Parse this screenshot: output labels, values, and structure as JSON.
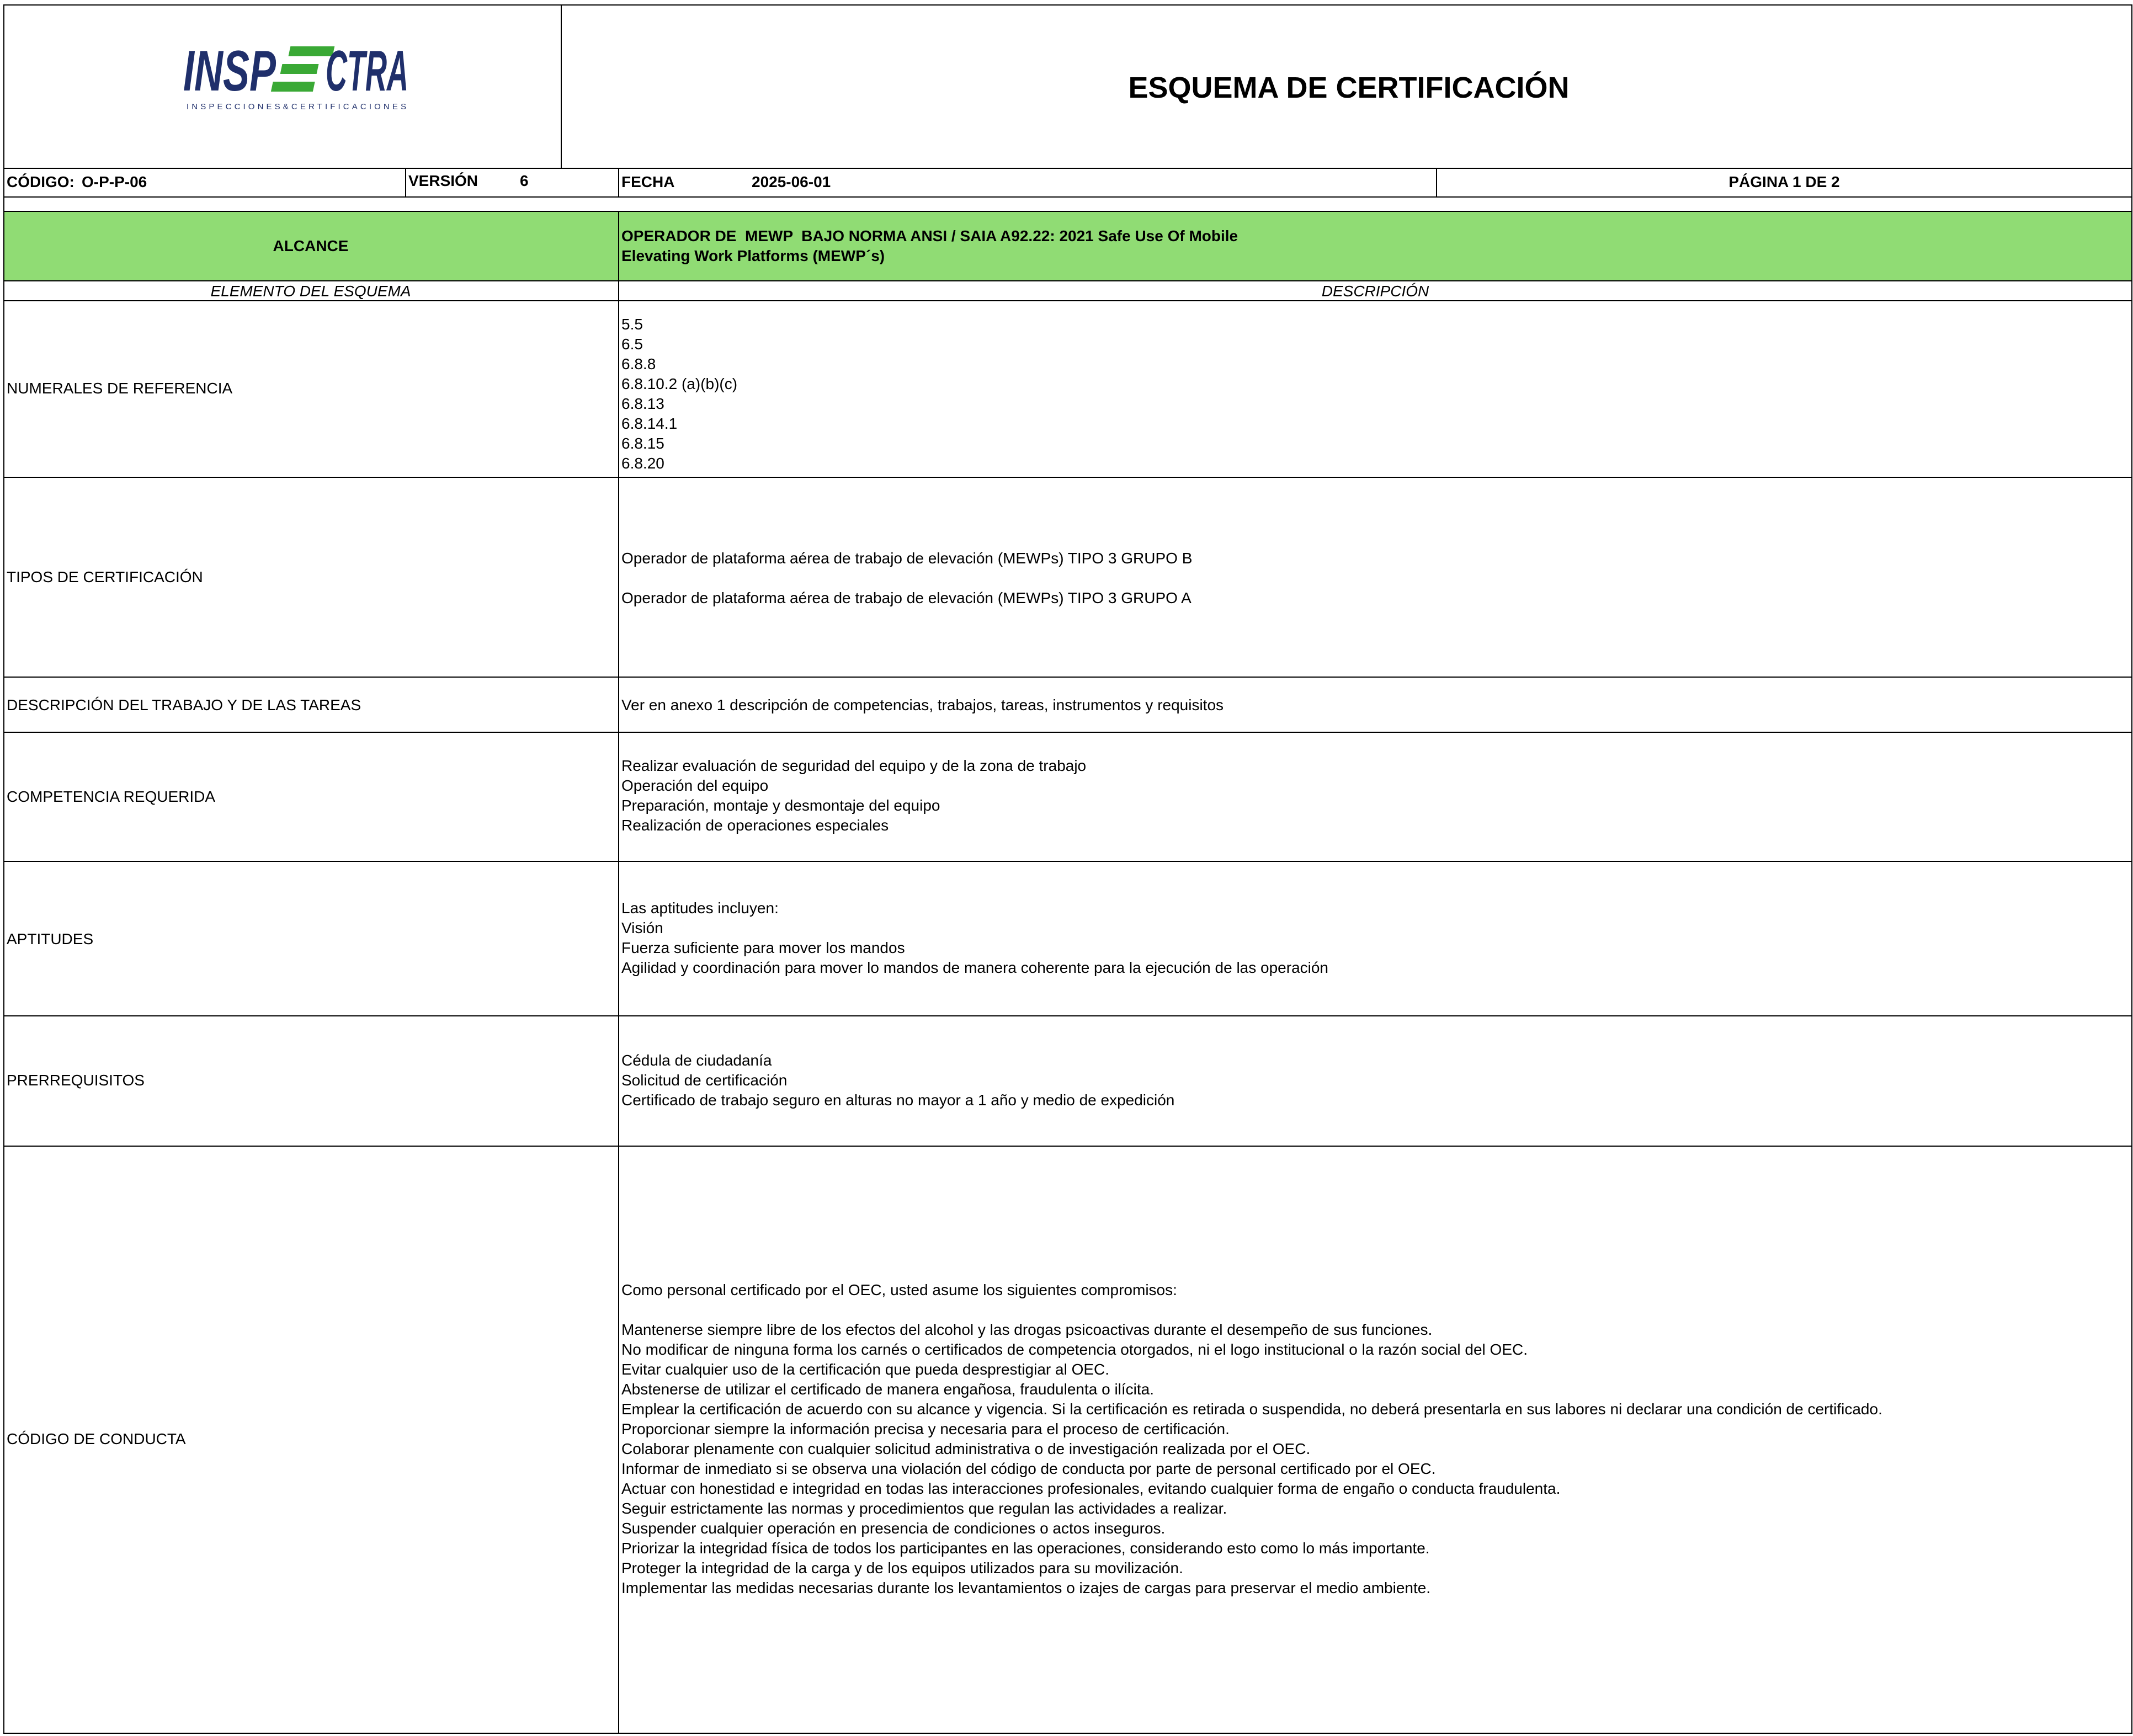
{
  "header": {
    "logo_text": "INSPECTRA",
    "logo_tagline": "INSPECCIONES&CERTIFICACIONES",
    "title": "ESQUEMA DE CERTIFICACIÓN",
    "codigo_label": "CÓDIGO:",
    "codigo_value": "O-P-P-06",
    "version_label": "VERSIÓN",
    "version_value": "6",
    "fecha_label": "FECHA",
    "fecha_value": "2025-06-01",
    "pagina": "PÁGINA 1 DE 2"
  },
  "alcance": {
    "label": "ALCANCE",
    "line1": "OPERADOR DE  MEWP  BAJO NORMA ANSI / SAIA A92.22: 2021 Safe Use Of Mobile",
    "line2": "Elevating Work Platforms (MEWP´s)"
  },
  "columns": {
    "left": "ELEMENTO DEL ESQUEMA",
    "right": "DESCRIPCIÓN"
  },
  "rows": {
    "numerales": {
      "label": "NUMERALES DE REFERENCIA",
      "items": [
        "5.5",
        "6.5",
        "6.8.8",
        "6.8.10.2 (a)(b)(c)",
        "6.8.13",
        "6.8.14.1",
        "6.8.15",
        "6.8.20"
      ]
    },
    "tipos": {
      "label": "TIPOS DE CERTIFICACIÓN",
      "items": [
        "Operador de plataforma aérea de trabajo de elevación (MEWPs) TIPO 3 GRUPO B",
        "Operador de plataforma aérea de trabajo de elevación (MEWPs) TIPO 3 GRUPO A"
      ]
    },
    "descripcion": {
      "label": "DESCRIPCIÓN DEL TRABAJO Y DE LAS TAREAS",
      "text": "Ver en anexo 1 descripción de competencias, trabajos, tareas, instrumentos y requisitos"
    },
    "competencia": {
      "label": "COMPETENCIA REQUERIDA",
      "items": [
        "Realizar evaluación de seguridad del equipo y de la zona de trabajo",
        "Operación del equipo",
        "Preparación, montaje y desmontaje del equipo",
        "Realización de operaciones especiales"
      ]
    },
    "aptitudes": {
      "label": "APTITUDES",
      "items": [
        "Las aptitudes incluyen:",
        "Visión",
        "Fuerza suficiente para mover los mandos",
        "Agilidad y coordinación para mover lo mandos de manera coherente para la ejecución de las operación"
      ]
    },
    "prerrequisitos": {
      "label": "PRERREQUISITOS",
      "items": [
        "Cédula de ciudadanía",
        "Solicitud de certificación",
        "Certificado de trabajo seguro en alturas no mayor a 1 año y medio de expedición"
      ]
    },
    "conducta": {
      "label": "CÓDIGO DE CONDUCTA",
      "intro": "Como personal certificado por el OEC, usted asume los siguientes compromisos:",
      "items": [
        "Mantenerse siempre libre de los efectos del alcohol y las drogas psicoactivas durante el desempeño de sus funciones.",
        "No modificar de ninguna forma los carnés o certificados de competencia otorgados, ni el logo institucional o la razón social del OEC.",
        "Evitar cualquier uso de la certificación que pueda desprestigiar al OEC.",
        "Abstenerse de utilizar el certificado de manera engañosa, fraudulenta o ilícita.",
        "Emplear la certificación de acuerdo con su alcance y vigencia. Si la certificación es retirada o suspendida, no deberá presentarla en sus labores ni declarar una condición de certificado.",
        "Proporcionar siempre la información precisa y necesaria para el proceso de certificación.",
        "Colaborar plenamente con cualquier solicitud administrativa o de investigación realizada por el OEC.",
        "Informar de inmediato si se observa una violación del código de conducta por parte de personal certificado por el OEC.",
        "Actuar con honestidad e integridad en todas las interacciones profesionales, evitando cualquier forma de engaño o conducta fraudulenta.",
        "Seguir estrictamente las normas y procedimientos que regulan las actividades a realizar.",
        "Suspender cualquier operación en presencia de condiciones o actos inseguros.",
        "Priorizar la integridad física de todos los participantes en las operaciones, considerando esto como lo más importante.",
        "Proteger la integridad de la carga y de los equipos utilizados para su movilización.",
        "Implementar las medidas necesarias durante los levantamientos o izajes de cargas para preservar el medio ambiente."
      ]
    }
  },
  "colors": {
    "alcance_bg": "#90dc74",
    "logo_blue": "#1f2f6b",
    "logo_green": "#3aa935"
  }
}
